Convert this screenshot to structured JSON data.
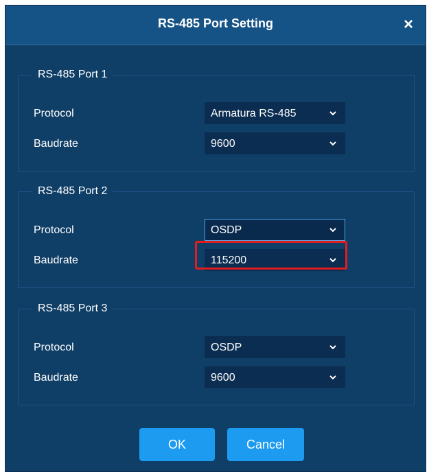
{
  "dialog": {
    "title": "RS-485 Port Setting",
    "close_icon": "close-icon"
  },
  "ports": [
    {
      "legend": "RS-485 Port 1",
      "protocol_label": "Protocol",
      "protocol_value": "Armatura RS-485",
      "baudrate_label": "Baudrate",
      "baudrate_value": "9600"
    },
    {
      "legend": "RS-485 Port 2",
      "protocol_label": "Protocol",
      "protocol_value": "OSDP",
      "baudrate_label": "Baudrate",
      "baudrate_value": "115200"
    },
    {
      "legend": "RS-485 Port 3",
      "protocol_label": "Protocol",
      "protocol_value": "OSDP",
      "baudrate_label": "Baudrate",
      "baudrate_value": "9600"
    }
  ],
  "buttons": {
    "ok_label": "OK",
    "cancel_label": "Cancel"
  },
  "colors": {
    "dialog_bg": "#0f3e66",
    "titlebar_bg": "#155286",
    "select_bg": "#0b2d51",
    "focus_border": "#4aa8ee",
    "highlight": "#e11d1d",
    "button_bg": "#1d9bf0"
  }
}
